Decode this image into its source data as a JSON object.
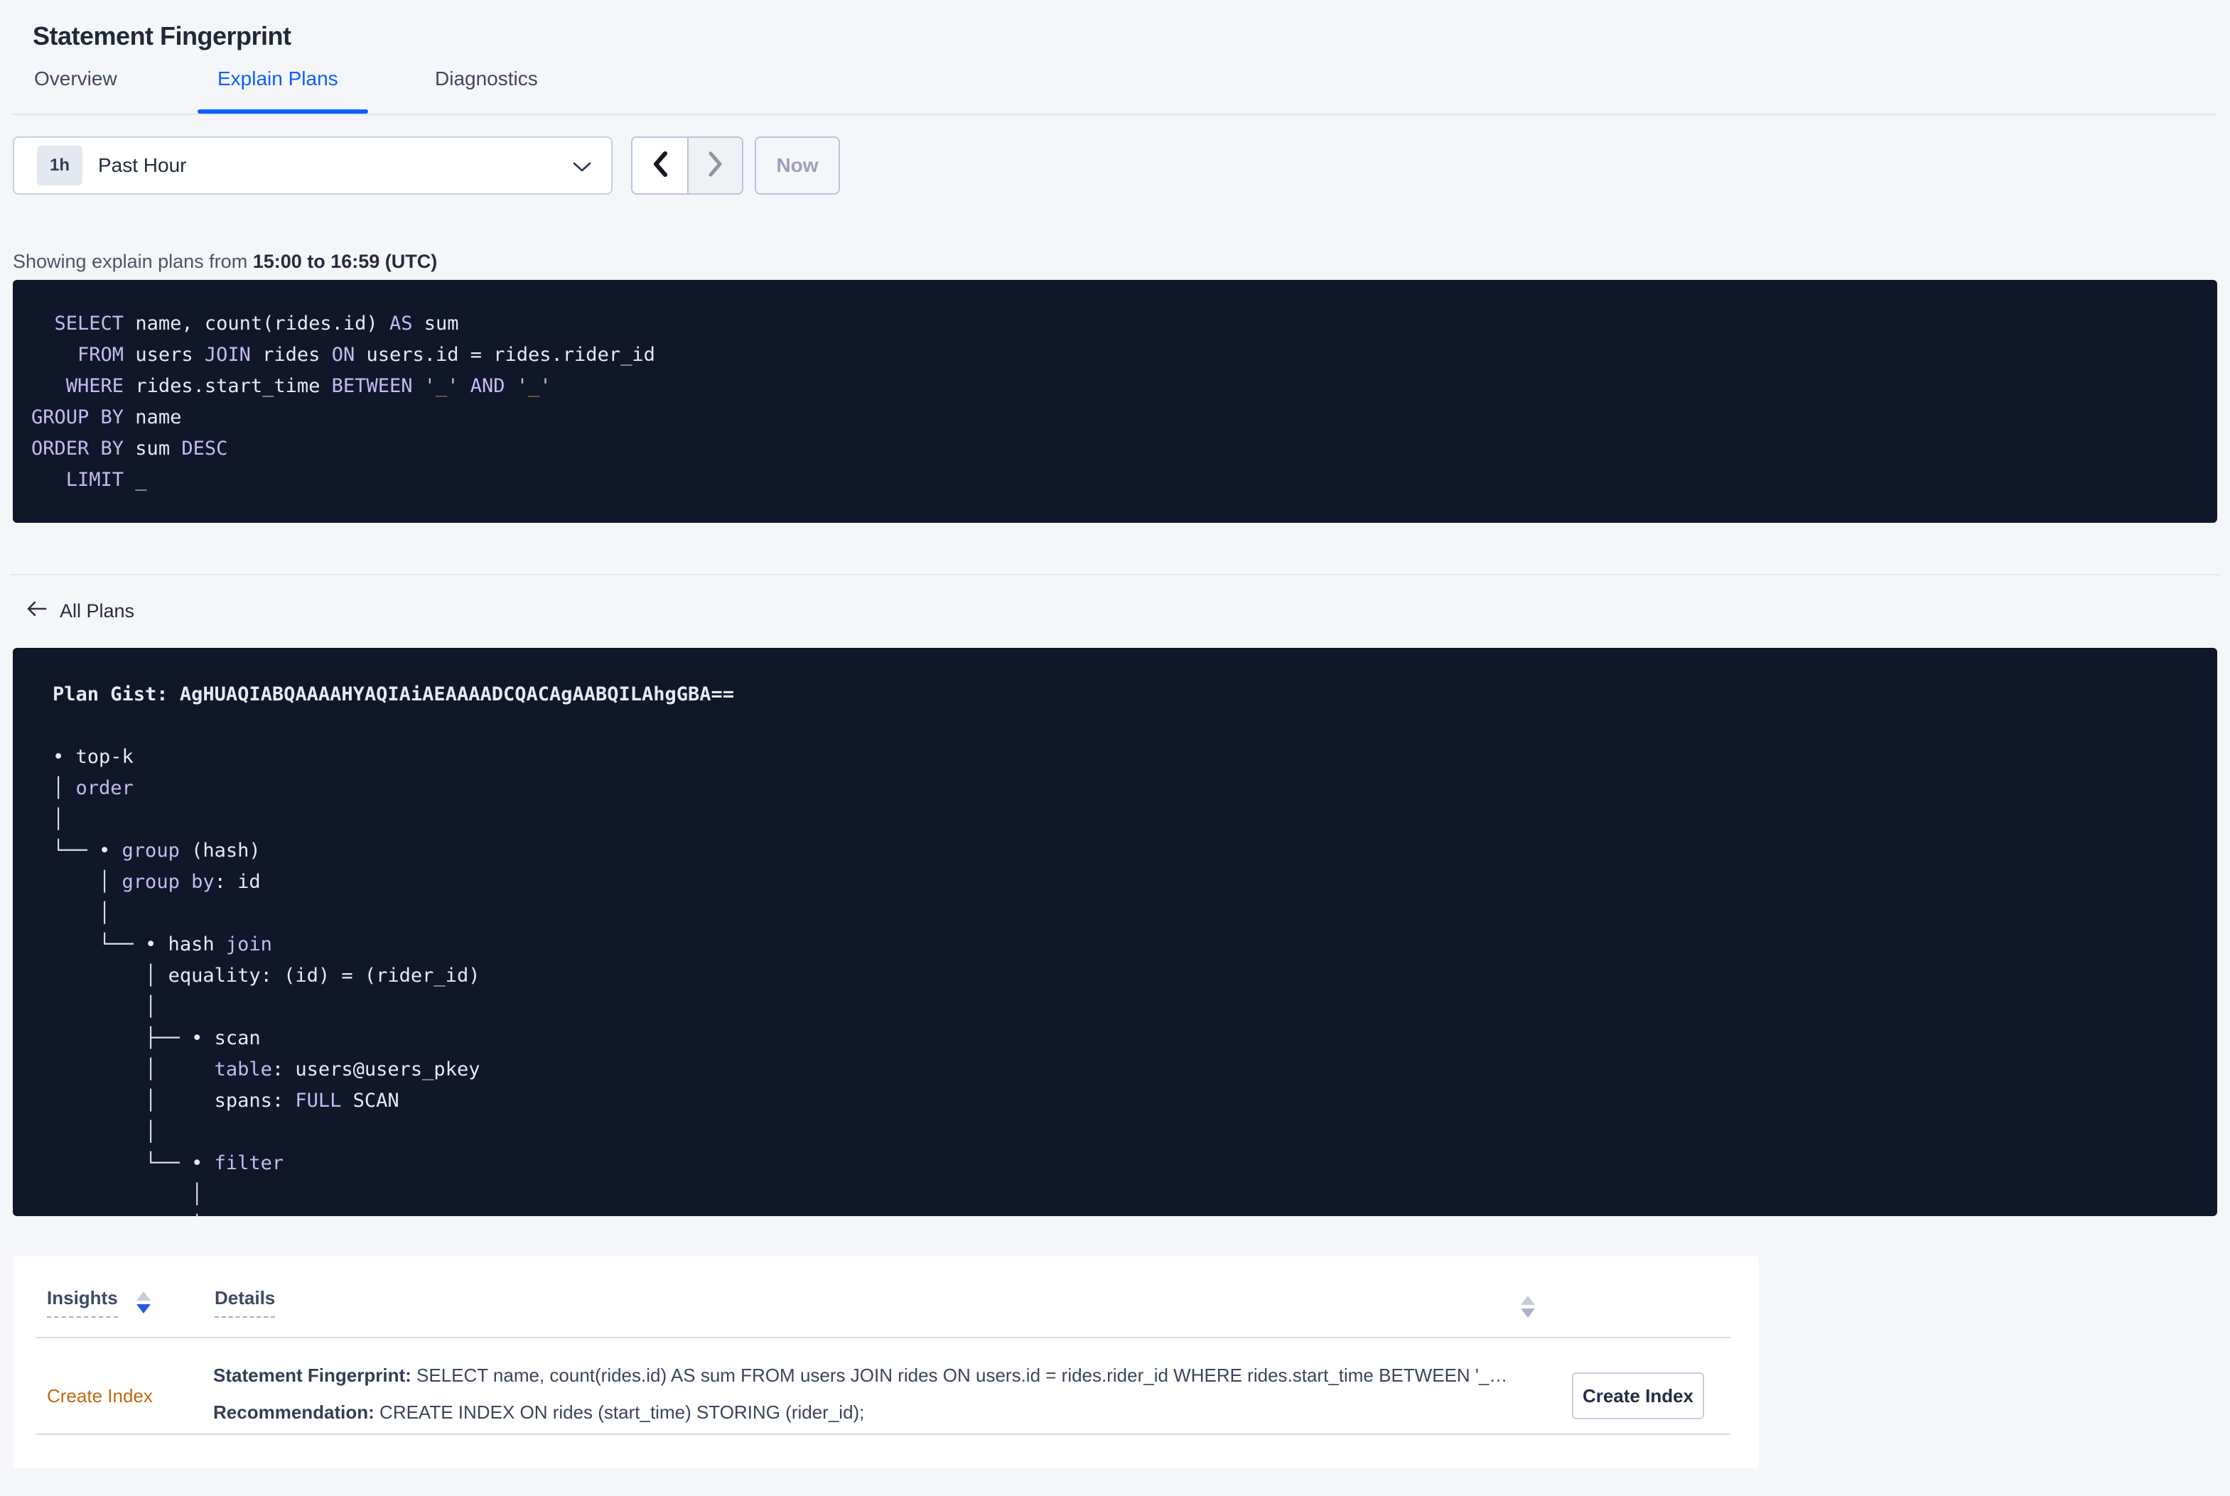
{
  "page": {
    "title": "Statement Fingerprint"
  },
  "tabs": [
    {
      "label": "Overview",
      "active": false
    },
    {
      "label": "Explain Plans",
      "active": true
    },
    {
      "label": "Diagnostics",
      "active": false
    }
  ],
  "time_controls": {
    "badge": "1h",
    "range": "Past Hour",
    "now": "Now",
    "prev_icon": "chevron-left",
    "next_icon": "chevron-right",
    "dropdown_icon": "chevron-down"
  },
  "status": {
    "prefix": "Showing explain plans from ",
    "range": "15:00 to 16:59 (UTC)"
  },
  "sql_lines": [
    [
      [
        "p",
        "  "
      ],
      [
        "k",
        "SELECT"
      ],
      [
        "p",
        " name, count(rides.id) "
      ],
      [
        "k",
        "AS"
      ],
      [
        "p",
        " sum"
      ]
    ],
    [
      [
        "p",
        "    "
      ],
      [
        "k",
        "FROM"
      ],
      [
        "p",
        " users "
      ],
      [
        "k",
        "JOIN"
      ],
      [
        "p",
        " rides "
      ],
      [
        "k",
        "ON"
      ],
      [
        "p",
        " users.id = rides.rider_id"
      ]
    ],
    [
      [
        "p",
        "   "
      ],
      [
        "k",
        "WHERE"
      ],
      [
        "p",
        " rides.start_time "
      ],
      [
        "k",
        "BETWEEN"
      ],
      [
        "p",
        " "
      ],
      [
        "k",
        "'"
      ],
      [
        "o",
        "_"
      ],
      [
        "k",
        "'"
      ],
      [
        "p",
        " "
      ],
      [
        "k",
        "AND"
      ],
      [
        "p",
        " "
      ],
      [
        "k",
        "'"
      ],
      [
        "o",
        "_"
      ],
      [
        "k",
        "'"
      ]
    ],
    [
      [
        "k",
        "GROUP BY"
      ],
      [
        "p",
        " name"
      ]
    ],
    [
      [
        "k",
        "ORDER BY"
      ],
      [
        "p",
        " sum "
      ],
      [
        "k",
        "DESC"
      ]
    ],
    [
      [
        "p",
        "   "
      ],
      [
        "k",
        "LIMIT"
      ],
      [
        "p",
        " _"
      ]
    ]
  ],
  "all_plans_label": "All Plans",
  "plan": {
    "gist_prefix": "Plan Gist: ",
    "gist": "AgHUAQIABQAAAAHYAQIAiAEAAAADCQACAgAABQILAhgGBA==",
    "tree": [
      [
        [
          "p",
          "• top-k"
        ]
      ],
      [
        [
          "c",
          "│ "
        ],
        [
          "k",
          "order"
        ]
      ],
      [
        [
          "c",
          "│"
        ]
      ],
      [
        [
          "c",
          "└── "
        ],
        [
          "p",
          "• "
        ],
        [
          "k",
          "group"
        ],
        [
          "p",
          " (hash)"
        ]
      ],
      [
        [
          "c",
          "    │ "
        ],
        [
          "k",
          "group by"
        ],
        [
          "p",
          ": id"
        ]
      ],
      [
        [
          "c",
          "    │"
        ]
      ],
      [
        [
          "c",
          "    └── "
        ],
        [
          "p",
          "• hash "
        ],
        [
          "k",
          "join"
        ]
      ],
      [
        [
          "c",
          "        │ "
        ],
        [
          "p",
          "equality: (id) = (rider_id)"
        ]
      ],
      [
        [
          "c",
          "        │"
        ]
      ],
      [
        [
          "c",
          "        ├── "
        ],
        [
          "p",
          "• scan"
        ]
      ],
      [
        [
          "c",
          "        │     "
        ],
        [
          "k",
          "table"
        ],
        [
          "p",
          ": users@users_pkey"
        ]
      ],
      [
        [
          "c",
          "        │     "
        ],
        [
          "p",
          "spans: "
        ],
        [
          "k",
          "FULL"
        ],
        [
          "p",
          " SCAN"
        ]
      ],
      [
        [
          "c",
          "        │"
        ]
      ],
      [
        [
          "c",
          "        └── "
        ],
        [
          "p",
          "• "
        ],
        [
          "k",
          "filter"
        ]
      ],
      [
        [
          "c",
          "            │"
        ]
      ],
      [
        [
          "c",
          "            │"
        ]
      ]
    ]
  },
  "insights": {
    "col_insights": "Insights",
    "col_details": "Details",
    "insights_sort": "desc",
    "details_sort": "none",
    "row": {
      "insight": "Create Index",
      "fingerprint_label": "Statement Fingerprint:",
      "fingerprint_text": " SELECT name, count(rides.id) AS sum FROM users JOIN rides ON users.id = rides.rider_id WHERE rides.start_time BETWEEN '_…",
      "recommendation_label": "Recommendation:",
      "recommendation_text": " CREATE INDEX ON rides (start_time) STORING (rider_id);",
      "action": "Create Index"
    }
  },
  "colors": {
    "accent_blue": "#0B5FFF",
    "sort_active_blue": "#2458E4",
    "insight_orange": "#BF690F",
    "code_bg": "#0F1729",
    "keyword_purple": "#C7B9F1",
    "code_plain": "#E6EAF3",
    "placeholder_orange": "#E08C0F",
    "page_bg": "#F5F6FA"
  }
}
